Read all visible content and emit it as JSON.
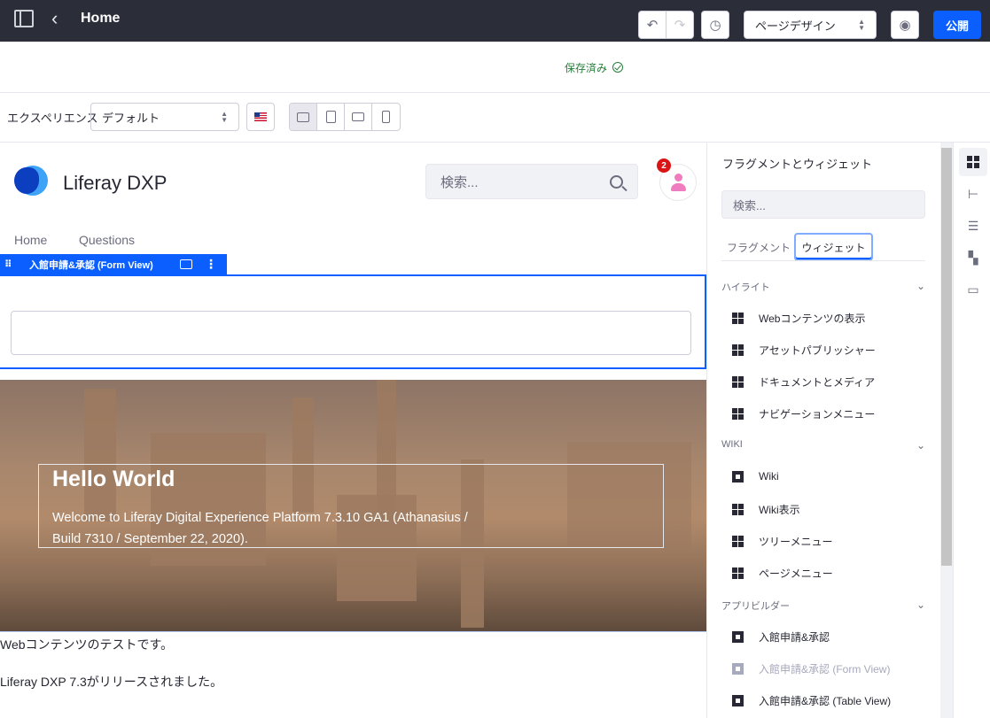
{
  "header": {
    "title": "Home"
  },
  "toolbar": {
    "saved_status": "保存済み",
    "design_select": "ページデザイン",
    "publish_label": "公開"
  },
  "experience": {
    "label": "エクスペリエンス",
    "selected": "デフォルト"
  },
  "site": {
    "name": "Liferay DXP",
    "search_placeholder": "検索...",
    "notification_count": "2",
    "nav": [
      "Home",
      "Questions"
    ]
  },
  "fragment": {
    "label": "入館申請&承認 (Form View)"
  },
  "hero": {
    "title": "Hello World",
    "text": "Welcome to Liferay Digital Experience Platform 7.3.10 GA1 (Athanasius / Build 7310 / September 22, 2020)."
  },
  "content": {
    "p1": "Webコンテンツのテストです。",
    "p2": "Liferay DXP 7.3がリリースされました。"
  },
  "panel": {
    "title": "フラグメントとウィジェット",
    "search_placeholder": "検索...",
    "tabs": [
      "フラグメント",
      "ウィジェット"
    ],
    "sections": [
      {
        "name": "ハイライト",
        "items": [
          "Webコンテンツの表示",
          "アセットパブリッシャー",
          "ドキュメントとメディア",
          "ナビゲーションメニュー"
        ]
      },
      {
        "name": "WIKI",
        "items": [
          "Wiki",
          "Wiki表示",
          "ツリーメニュー",
          "ページメニュー"
        ]
      },
      {
        "name": "アプリビルダー",
        "items": [
          "入館申請&承認",
          "入館申請&承認 (Form View)",
          "入館申請&承認 (Table View)"
        ]
      }
    ]
  },
  "colors": {
    "topbar": "#2b2d38",
    "primary": "#0b5fff",
    "saved": "#287d3c"
  }
}
